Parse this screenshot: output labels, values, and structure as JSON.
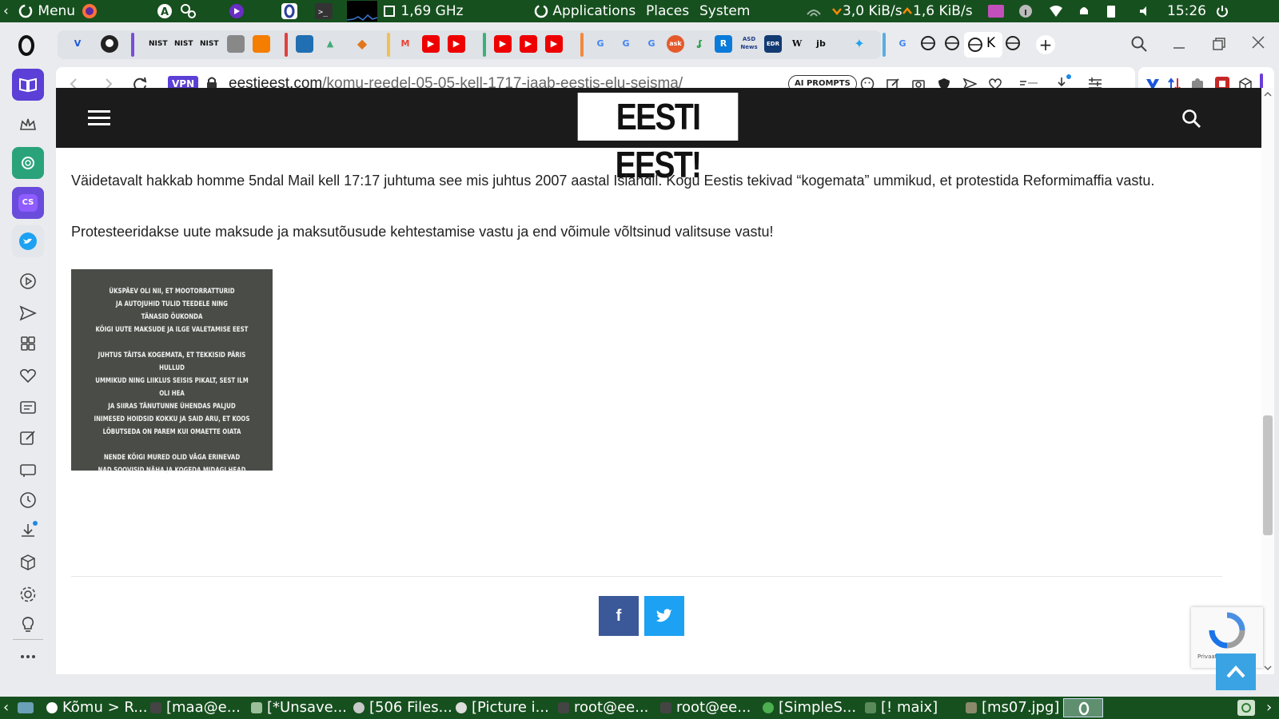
{
  "system_panel": {
    "menu_label": "Menu",
    "cpu_freq": "1,69 GHz",
    "applications_label": "Applications",
    "places_label": "Places",
    "system_label": "System",
    "net_down": "3,0 KiB/s",
    "net_up": "1,6 KiB/s",
    "clock": "15:26"
  },
  "tabs": {
    "group1": [
      "NIST",
      "NIST",
      "NIST"
    ],
    "active_tab_label": "K"
  },
  "address_bar": {
    "vpn_badge": "VPN",
    "url_domain": "eestieest.com",
    "url_path": "/komu-reedel-05-05-kell-1717-jaab-eestis-elu-seisma/",
    "ai_prompts_label": "AI PROMPTS"
  },
  "site": {
    "logo_text": "EESTI EEST!"
  },
  "article": {
    "paragraph1": "Väidetavalt hakkab homme 5ndal Mail kell 17:17 juhtuma see mis juhtus 2007 aastal Islandil. Kogu Eestis tekivad “kogemata” ummikud, et protestida Reformimaffia vastu.",
    "paragraph2": "Protesteeridakse uute maksude ja maksutõusude kehtestamise vastu ja end võimule võltsinud valitsuse vastu!",
    "image_lines": [
      "ÜKSPÄEV OLI NII, ET MOOTORRATTURID",
      "JA AUTOJUHID TULID TEEDELE NING",
      "TÄNASID ÕUKONDA",
      "KÕIGI UUTE MAKSUDE JA ILGE VALETAMISE EEST",
      "",
      "JUHTUS TÄITSA  KOGEMATA, ET TEKKISID PÄRIS HULLUD",
      "UMMIKUD NING LIIKLUS SEISIS PIKALT, SEST ILM OLI HEA",
      "JA SIIRAS TÄNUTUNNE ÜHENDAS PALJUD",
      "INIMESED HOIDSID KOKKU JA SAID ARU, ET KOOS",
      "LÕBUTSEDA ON PAREM KUI OMAETTE OIATA",
      "",
      "NENDE KÕIGI MURED OLID VÄGA ERINEVAD",
      "NAD SOOVISID NÄHA JA KOGEDA MIDAGI HEAD"
    ]
  },
  "share": {
    "facebook_label": "f"
  },
  "recaptcha": {
    "label": "Privaats"
  },
  "taskbar": {
    "items": [
      "Kõmu > R...",
      "[maa@e...",
      "[*Unsave...",
      "[506 Files...",
      "[Picture i...",
      "root@ee...",
      "root@ee...",
      "[SimpleS...",
      "[! maix]",
      "[ms07.jpg]"
    ]
  },
  "colors": {
    "panel_green": "#17501f",
    "site_header": "#1b1b1b",
    "facebook_blue": "#3b5998",
    "twitter_blue": "#1da1f2",
    "scroll_top_blue": "#3aa3e3",
    "vpn_purple": "#5b3fd6"
  }
}
